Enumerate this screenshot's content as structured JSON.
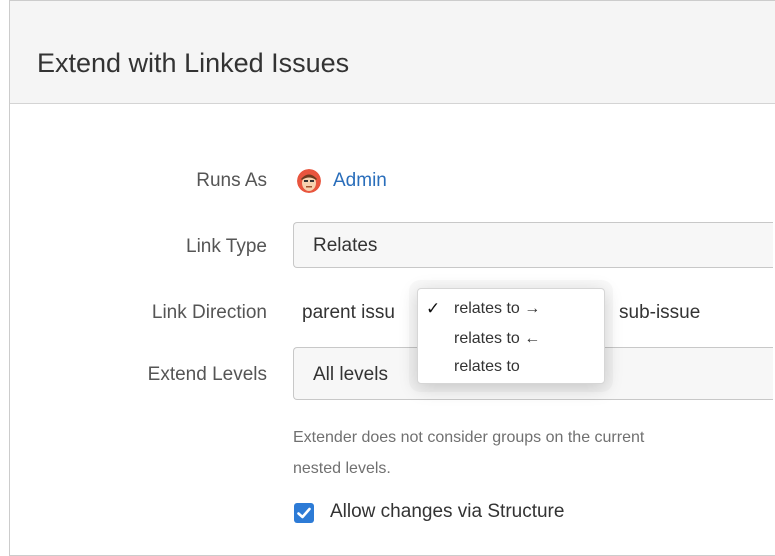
{
  "dialog": {
    "title": "Extend with Linked Issues"
  },
  "form": {
    "runs_as": {
      "label": "Runs As",
      "value": "Admin"
    },
    "link_type": {
      "label": "Link Type",
      "value": "Relates"
    },
    "link_direction": {
      "label": "Link Direction",
      "left_text": "parent issu",
      "right_text": "sub-issue",
      "options": [
        {
          "label": "relates to →",
          "checked": true
        },
        {
          "label": "relates to ←",
          "checked": false
        },
        {
          "label": "relates to",
          "checked": false
        }
      ],
      "check_glyph": "✓"
    },
    "extend_levels": {
      "label": "Extend Levels",
      "value": "All levels"
    },
    "help_text": {
      "line1": "Extender does not consider groups on the current",
      "line2": "nested levels."
    },
    "allow_changes": {
      "label": "Allow changes via Structure",
      "checked": true
    }
  },
  "colors": {
    "link": "#2a6ebb",
    "checkbox": "#2d7bd6",
    "header_bg": "#f5f5f5"
  },
  "icons": {
    "avatar": "admin-avatar-icon",
    "check": "checkmark-icon",
    "checkbox": "checkbox-checked-icon"
  }
}
